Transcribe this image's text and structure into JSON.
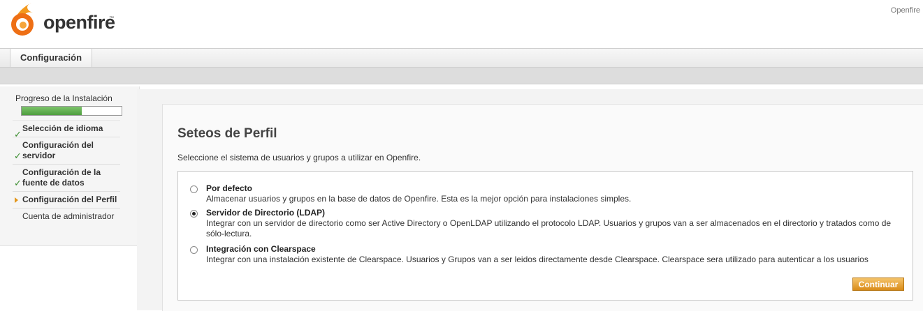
{
  "app": {
    "logo_text": "openfire",
    "logo_tm": "™",
    "top_right_label": "Openfire"
  },
  "nav": {
    "tab_label": "Configuración"
  },
  "sidebar": {
    "progress_title": "Progreso de la Instalación",
    "progress_fraction": 0.6,
    "steps": [
      {
        "label": "Selección de idioma",
        "status": "done"
      },
      {
        "label": "Configuración del servidor",
        "status": "done"
      },
      {
        "label": "Configuración de la fuente de datos",
        "status": "done"
      },
      {
        "label": "Configuración del Perfil",
        "status": "current"
      },
      {
        "label": "Cuenta de administrador",
        "status": "pending"
      }
    ]
  },
  "main": {
    "title": "Seteos de Perfil",
    "description": "Seleccione el sistema de usuarios y grupos a utilizar en Openfire.",
    "options": [
      {
        "title": "Por defecto",
        "detail": "Almacenar usuarios y grupos en la base de datos de Openfire. Esta es la mejor opción para instalaciones simples.",
        "selected": false
      },
      {
        "title": "Servidor de Directorio (LDAP)",
        "detail": "Integrar con un servidor de directorio como ser Active Directory o OpenLDAP utilizando el protocolo LDAP. Usuarios y grupos van a ser almacenados en el directorio y tratados como de sólo-lectura.",
        "selected": true
      },
      {
        "title": "Integración con Clearspace",
        "detail": "Integrar con una instalación existente de Clearspace. Usuarios y Grupos van a ser leidos directamente desde Clearspace. Clearspace sera utilizado para autenticar a los usuarios",
        "selected": false
      }
    ],
    "continue_label": "Continuar"
  },
  "colors": {
    "accent_orange": "#e3961a",
    "progress_green": "#4f9e3f",
    "check_green": "#3a8d2e"
  },
  "icons": {
    "logo": "openfire-flame-icon",
    "done": "checkmark-icon",
    "current": "arrow-right-icon"
  }
}
